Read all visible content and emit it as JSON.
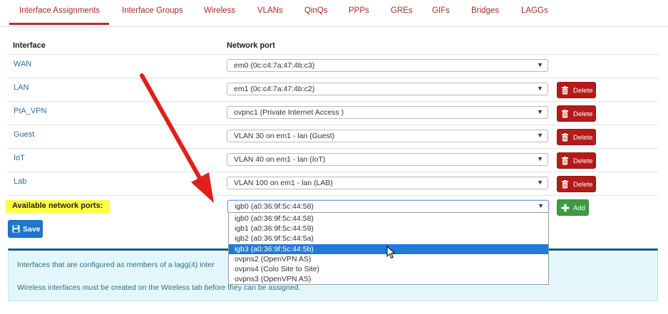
{
  "tabs": [
    {
      "label": "Interface Assignments"
    },
    {
      "label": "Interface Groups"
    },
    {
      "label": "Wireless"
    },
    {
      "label": "VLANs"
    },
    {
      "label": "QinQs"
    },
    {
      "label": "PPPs"
    },
    {
      "label": "GREs"
    },
    {
      "label": "GIFs"
    },
    {
      "label": "Bridges"
    },
    {
      "label": "LAGGs"
    }
  ],
  "table": {
    "headers": {
      "interface": "Interface",
      "port": "Network port"
    },
    "rows": [
      {
        "name": "WAN",
        "port": "em0 (0c:c4:7a:47:4b:c3)"
      },
      {
        "name": "LAN",
        "port": "em1 (0c:c4:7a:47:4b:c2)",
        "action": "Delete"
      },
      {
        "name": "PIA_VPN",
        "port": "ovpnc1 (Private Internet Access )",
        "action": "Delete"
      },
      {
        "name": "Guest",
        "port": "VLAN 30 on em1 - lan (Guest)",
        "action": "Delete"
      },
      {
        "name": "IoT",
        "port": "VLAN 40 on em1 - lan (IoT)",
        "action": "Delete"
      },
      {
        "name": "Lab",
        "port": "VLAN 100 on em1 - lan (LAB)",
        "action": "Delete"
      }
    ],
    "available": {
      "label": "Available network ports:",
      "selected": "igb0 (a0:36:9f:5c:44:58)",
      "add_label": "Add"
    }
  },
  "dropdown": {
    "options": [
      "igb0 (a0:36:9f:5c:44:58)",
      "igb1 (a0:36:9f:5c:44:59)",
      "igb2 (a0:36:9f:5c:44:5a)",
      "igb3 (a0:36:9f:5c:44:5b)",
      "ovpns2 (OpenVPN AS)",
      "ovpns4 (Colo Site to Site)",
      "ovpns3 (OpenVPN AS)"
    ],
    "highlighted_index": 3
  },
  "save_label": "Save",
  "info": {
    "line1_start": "Interfaces that are configured as members of a lagg(4) inter",
    "line2": "Wireless interfaces must be created on the Wireless tab before they can be assigned."
  },
  "colors": {
    "tab_text": "#a52a2a",
    "delete": "#b31b1b",
    "add": "#3e9b42",
    "save": "#1f77c9",
    "highlight": "#ffff44",
    "arrow": "#e0201b"
  },
  "icons": {
    "delete": "trash-icon",
    "add": "plus-icon",
    "save": "floppy-disk-icon",
    "select": "caret-down-icon"
  }
}
